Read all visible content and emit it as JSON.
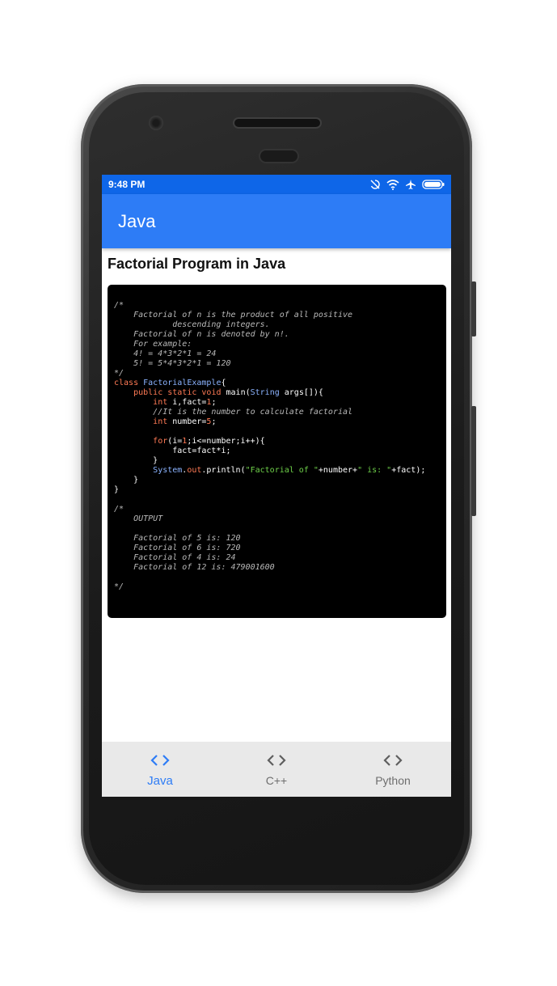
{
  "status_bar": {
    "time": "9:48 PM",
    "icons": [
      "sync-off-icon",
      "wifi-icon",
      "airplane-icon",
      "battery-icon"
    ]
  },
  "app_bar": {
    "title": "Java"
  },
  "content": {
    "heading": "Factorial Program in Java",
    "code": "/*\n    Factorial of n is the product of all positive\n            descending integers.\n    Factorial of n is denoted by n!.\n    For example:\n    4! = 4*3*2*1 = 24\n    5! = 5*4*3*2*1 = 120\n*/\nclass FactorialExample{\n    public static void main(String args[]){\n        int i,fact=1;\n        //It is the number to calculate factorial\n        int number=5;\n\n        for(i=1;i<=number;i++){\n            fact=fact*i;\n        }\n        System.out.println(\"Factorial of \"+number+\" is: \"+fact);\n    }\n}\n\n/*\n    OUTPUT\n\n    Factorial of 5 is: 120\n    Factorial of 6 is: 720\n    Factorial of 4 is: 24\n    Factorial of 12 is: 479001600\n\n*/"
  },
  "bottom_nav": {
    "items": [
      {
        "label": "Java",
        "icon": "code-icon",
        "active": true
      },
      {
        "label": "C++",
        "icon": "code-icon",
        "active": false
      },
      {
        "label": "Python",
        "icon": "code-icon",
        "active": false
      }
    ]
  },
  "colors": {
    "accent": "#2d7cf6",
    "status_bar": "#0e66e8",
    "code_bg": "#000000"
  }
}
